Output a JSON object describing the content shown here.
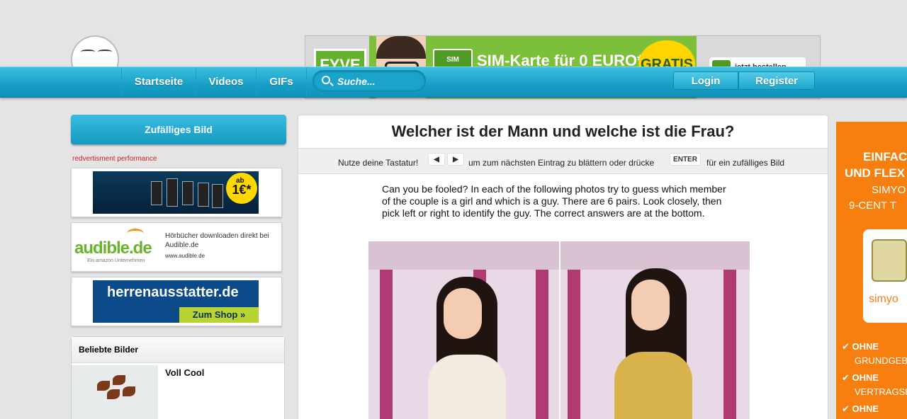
{
  "top_ad": {
    "brand": "FYVE",
    "sim_tag": "SIM KARTE",
    "headline": "SIM-Karte für 0 EURO*",
    "badge": "GRATIS",
    "button": "jetzt bestellen"
  },
  "nav": {
    "items": [
      {
        "label": "Startseite"
      },
      {
        "label": "Videos"
      },
      {
        "label": "GIFs"
      }
    ],
    "search_placeholder": "Suche...",
    "login": "Login",
    "register": "Register"
  },
  "sidebar": {
    "random_button": "Zufälliges Bild",
    "ad_label": "redvertisment performance",
    "ad1": {
      "price_small": "ab",
      "price": "1€*"
    },
    "ad2": {
      "logo": "audible.de",
      "sub": "Ein amazon Unternehmen",
      "text": "Hörbücher downloaden direkt bei Audible.de",
      "url": "www.audible.de"
    },
    "ad3": {
      "name": "herrenausstatter.de",
      "cta": "Zum Shop »"
    },
    "popular": {
      "header": "Beliebte Bilder",
      "items": [
        {
          "title": "Voll Cool"
        }
      ]
    }
  },
  "main": {
    "title": "Welcher ist der Mann und welche ist die Frau?",
    "kbd": {
      "prefix": "Nutze deine Tastatur!",
      "left_key": "◀",
      "right_key": "▶",
      "middle": "um zum nächsten Eintrag zu blättern oder drücke",
      "enter_key": "ENTER",
      "suffix": "für ein zufälliges Bild"
    },
    "intro": "Can you be fooled? In each of the following photos try to guess which member of the couple is a girl and which is a guy. There are 6 pairs. Look closely, then pick left or right to identify the guy. The correct answers are at the bottom."
  },
  "right_ad": {
    "line1": "EINFAC",
    "line2": "UND FLEX",
    "line3": "SIMYO",
    "line4": "9-CENT T",
    "sim_brand": "simyo",
    "bullets": [
      {
        "bold": "OHNE",
        "rest": "GRUNDGEBÜ"
      },
      {
        "bold": "OHNE",
        "rest": "VERTRAGSB"
      },
      {
        "bold": "OHNE",
        "rest": ""
      }
    ]
  },
  "colors": {
    "nav_blue": "#189ec6",
    "accent_red": "#d0202a",
    "ad_orange": "#f77f10",
    "ad_green": "#7cbf3a"
  }
}
